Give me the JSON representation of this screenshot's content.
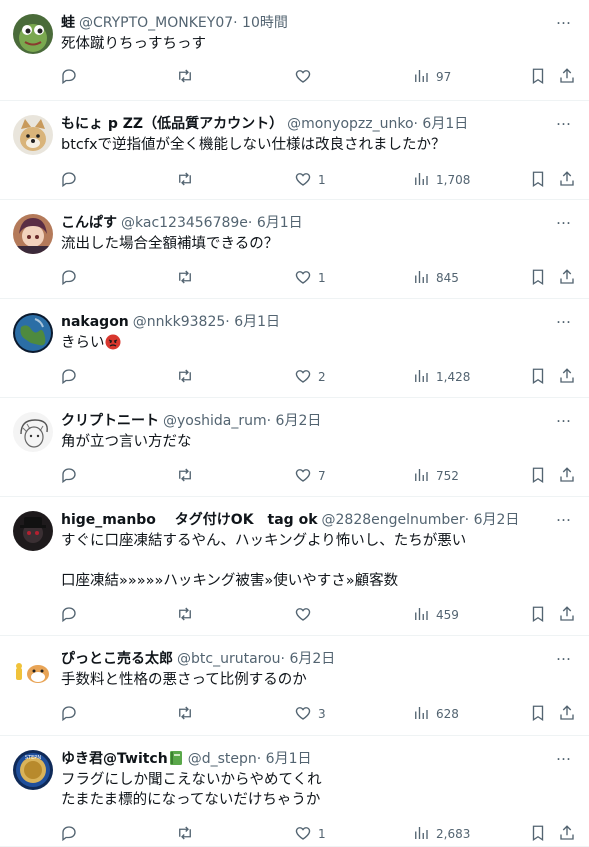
{
  "tweets": [
    {
      "name": "蛙",
      "handle": "@CRYPTO_MONKEY07",
      "time": "10時間",
      "body": "死体蹴りちっすちっす",
      "likes": "",
      "views": "97",
      "avatar": "frog"
    },
    {
      "name": "もにょ p  ZZ（低品質アカウント）",
      "handle": "@monyopzz_unko",
      "time": "6月1日",
      "body": "btcfxで逆指値が全く機能しない仕様は改良されましたか？",
      "likes": "1",
      "views": "1,708",
      "avatar": "dog"
    },
    {
      "name": "こんぱす",
      "handle": "@kac123456789e",
      "time": "6月1日",
      "body": "流出した場合全額補填できるの？",
      "likes": "1",
      "views": "845",
      "avatar": "anime"
    },
    {
      "name": "nakagon",
      "handle": "@nnkk93825",
      "time": "6月1日",
      "body": "きらい",
      "likes": "2",
      "views": "1,428",
      "avatar": "earth",
      "emoji": "angry-face"
    },
    {
      "name": "クリプトニート",
      "handle": "@yoshida_rum",
      "time": "6月2日",
      "body": "角が立つ言い方だな",
      "likes": "7",
      "views": "752",
      "avatar": "sketch"
    },
    {
      "name": "hige_manbo　 タグ付けOK　tag ok",
      "handle": "@2828engelnumber",
      "time": "6月2日",
      "body": "すぐに口座凍結するやん、ハッキングより怖いし、たちが悪い\n\n口座凍結»»»»»ハッキング被害»使いやすさ»顧客数",
      "likes": "",
      "views": "459",
      "avatar": "dark"
    },
    {
      "name": "ぴっとこ売る太郎",
      "handle": "@btc_urutarou",
      "time": "6月2日",
      "body": "手数料と性格の悪さって比例するのか",
      "likes": "3",
      "views": "628",
      "avatar": "hamster"
    },
    {
      "name": "ゆき君@Twitch",
      "handle": "@d_stepn",
      "time": "6月1日",
      "body": "フラグにしか聞こえないからやめてくれ\nたまたま標的になってないだけちゃうか",
      "likes": "1",
      "views": "2,683",
      "avatar": "coin",
      "badge": "green-book-emoji"
    }
  ],
  "separator": "·",
  "more_icon": "…",
  "colors": {
    "text": "#0f1419",
    "secondary": "#536471",
    "border": "#eff3f4"
  }
}
